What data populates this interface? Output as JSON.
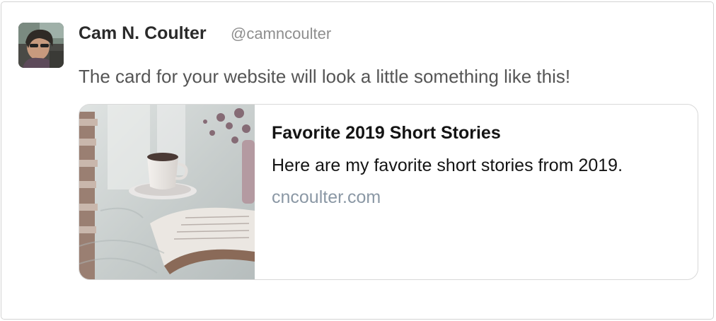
{
  "tweet": {
    "author": {
      "name": "Cam N. Coulter",
      "handle": "@camncoulter",
      "avatar_icon": "author-avatar"
    },
    "text": "The card for your website will look a little something like this!",
    "card": {
      "image_icon": "coffee-cup-and-open-book-photo",
      "title": "Favorite 2019 Short Stories",
      "description": "Here are my favorite short stories from 2019.",
      "domain": "cncoulter.com"
    }
  },
  "colors": {
    "name": "#2a2a2a",
    "handle": "#8e8e8e",
    "tweet_text": "#555555",
    "card_text": "#141414",
    "card_domain": "#8b98a5",
    "border": "#d4d4d4"
  }
}
